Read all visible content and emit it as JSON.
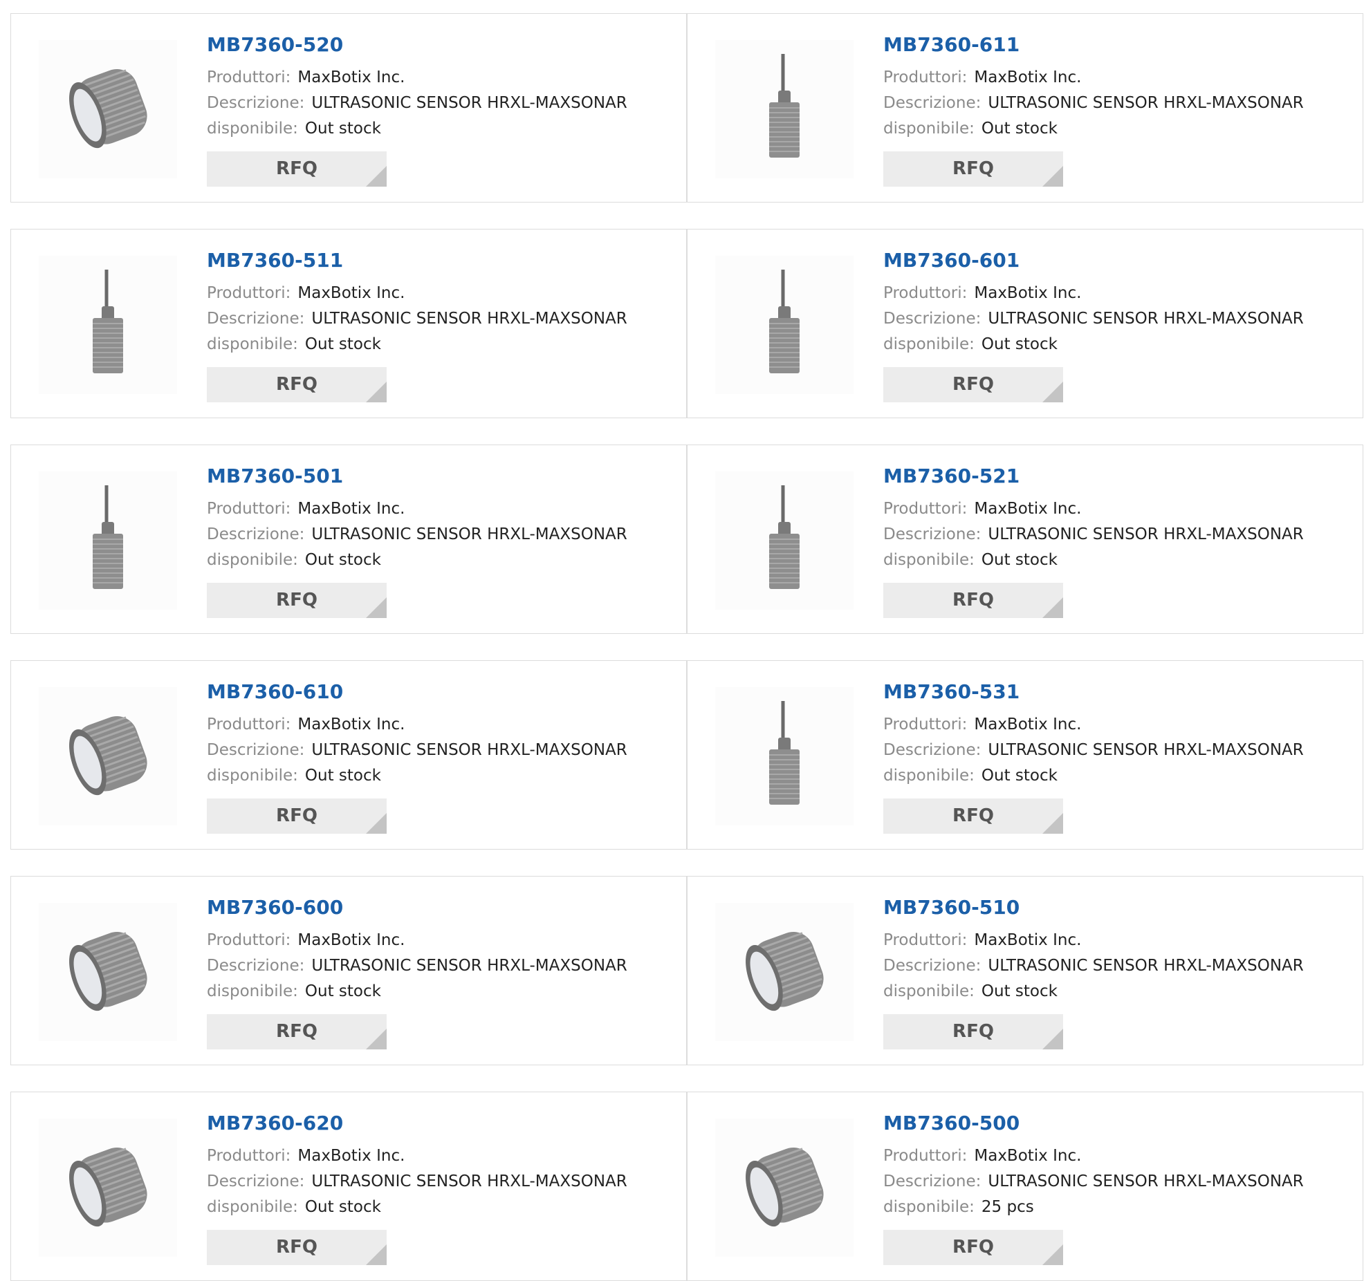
{
  "labels": {
    "manufacturer": "Produttori:",
    "description": "Descrizione:",
    "availability": "disponibile:",
    "rfq": "RFQ"
  },
  "products": [
    {
      "part": "MB7360-520",
      "manufacturer": "MaxBotix Inc.",
      "description": "ULTRASONIC SENSOR HRXL-MAXSONAR",
      "availability": "Out stock",
      "image": "round-sensor-icon"
    },
    {
      "part": "MB7360-611",
      "manufacturer": "MaxBotix Inc.",
      "description": "ULTRASONIC SENSOR HRXL-MAXSONAR",
      "availability": "Out stock",
      "image": "cabled-sensor-icon"
    },
    {
      "part": "MB7360-511",
      "manufacturer": "MaxBotix Inc.",
      "description": "ULTRASONIC SENSOR HRXL-MAXSONAR",
      "availability": "Out stock",
      "image": "cabled-sensor-icon"
    },
    {
      "part": "MB7360-601",
      "manufacturer": "MaxBotix Inc.",
      "description": "ULTRASONIC SENSOR HRXL-MAXSONAR",
      "availability": "Out stock",
      "image": "cabled-sensor-icon"
    },
    {
      "part": "MB7360-501",
      "manufacturer": "MaxBotix Inc.",
      "description": "ULTRASONIC SENSOR HRXL-MAXSONAR",
      "availability": "Out stock",
      "image": "cabled-sensor-icon"
    },
    {
      "part": "MB7360-521",
      "manufacturer": "MaxBotix Inc.",
      "description": "ULTRASONIC SENSOR HRXL-MAXSONAR",
      "availability": "Out stock",
      "image": "cabled-sensor-icon"
    },
    {
      "part": "MB7360-610",
      "manufacturer": "MaxBotix Inc.",
      "description": "ULTRASONIC SENSOR HRXL-MAXSONAR",
      "availability": "Out stock",
      "image": "round-sensor-icon"
    },
    {
      "part": "MB7360-531",
      "manufacturer": "MaxBotix Inc.",
      "description": "ULTRASONIC SENSOR HRXL-MAXSONAR",
      "availability": "Out stock",
      "image": "cabled-sensor-icon"
    },
    {
      "part": "MB7360-600",
      "manufacturer": "MaxBotix Inc.",
      "description": "ULTRASONIC SENSOR HRXL-MAXSONAR",
      "availability": "Out stock",
      "image": "round-sensor-icon"
    },
    {
      "part": "MB7360-510",
      "manufacturer": "MaxBotix Inc.",
      "description": "ULTRASONIC SENSOR HRXL-MAXSONAR",
      "availability": "Out stock",
      "image": "round-sensor-icon"
    },
    {
      "part": "MB7360-620",
      "manufacturer": "MaxBotix Inc.",
      "description": "ULTRASONIC SENSOR HRXL-MAXSONAR",
      "availability": "Out stock",
      "image": "round-sensor-icon"
    },
    {
      "part": "MB7360-500",
      "manufacturer": "MaxBotix Inc.",
      "description": "ULTRASONIC SENSOR HRXL-MAXSONAR",
      "availability": "25 pcs",
      "image": "round-sensor-icon"
    }
  ],
  "colors": {
    "part_link": "#1b5fa8",
    "label": "#8a8a8a",
    "value": "#222222",
    "rfq_bg": "#ececec",
    "rfq_corner": "#c4c4c4",
    "card_border": "#dcdcdc"
  }
}
